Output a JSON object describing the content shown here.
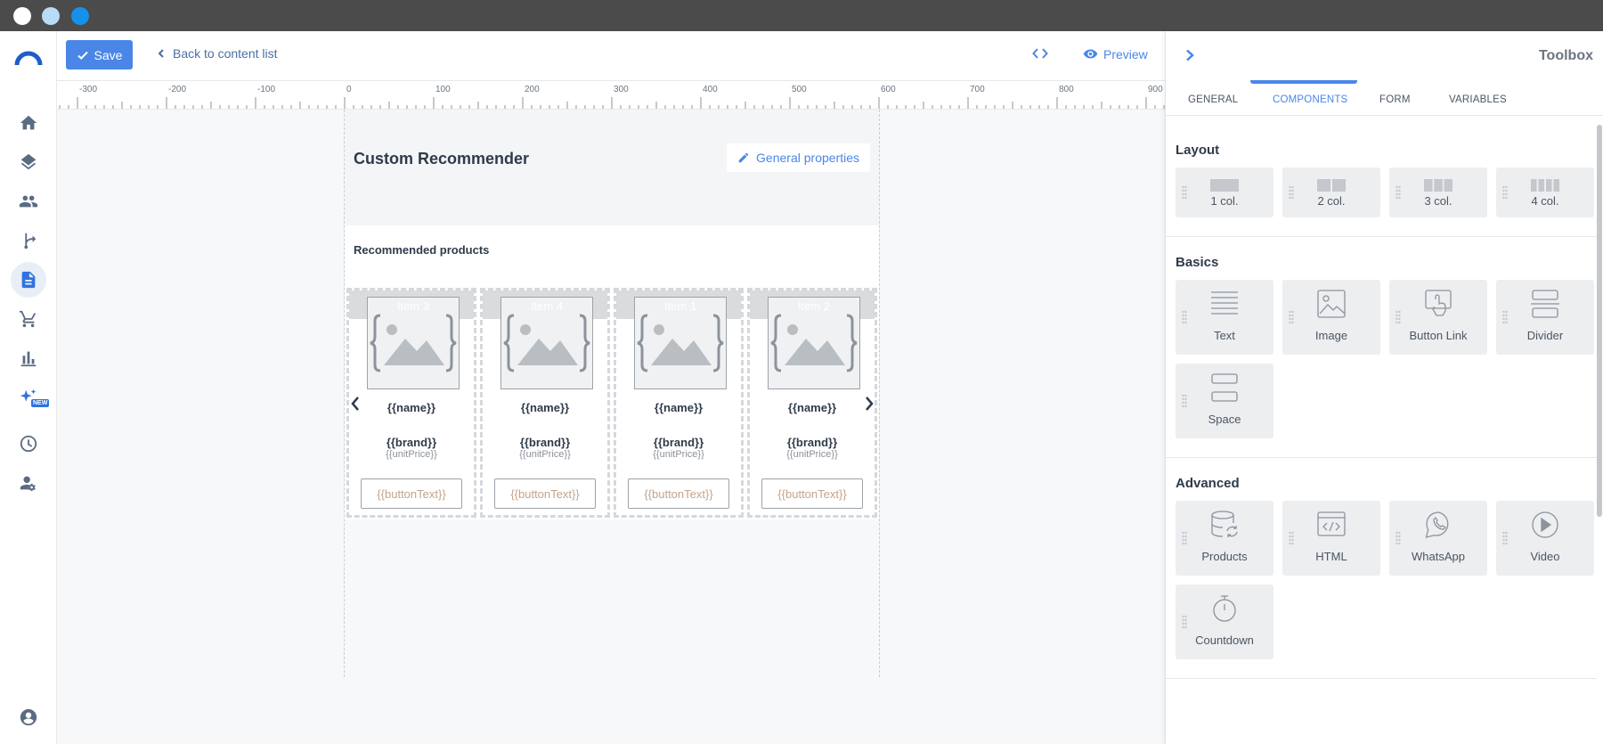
{
  "window": {
    "buttons": [
      "close",
      "minimize",
      "maximize"
    ]
  },
  "sidebar": {
    "items": [
      {
        "name": "home",
        "icon": "home-icon"
      },
      {
        "name": "layers",
        "icon": "layers-icon"
      },
      {
        "name": "people",
        "icon": "people-icon"
      },
      {
        "name": "journeys",
        "icon": "branch-icon"
      },
      {
        "name": "content",
        "icon": "document-icon",
        "active": true
      },
      {
        "name": "commerce",
        "icon": "cart-icon"
      },
      {
        "name": "analytics",
        "icon": "bar-chart-icon"
      },
      {
        "name": "ai",
        "icon": "sparkles-icon",
        "badge": "NEW"
      },
      {
        "name": "dashboard",
        "icon": "gauge-icon"
      },
      {
        "name": "user-settings",
        "icon": "user-gear-icon"
      }
    ],
    "account_icon": "account-circle-icon"
  },
  "topbar": {
    "save_label": "Save",
    "back_label": "Back to content list",
    "preview_label": "Preview"
  },
  "ruler": {
    "labels": [
      "-300",
      "-200",
      "-100",
      "0",
      "100",
      "200",
      "300",
      "400",
      "500",
      "600",
      "700",
      "800",
      "900"
    ]
  },
  "email": {
    "title": "Custom Recommender",
    "general_properties_label": "General properties",
    "recommended_title": "Recommended products",
    "cards": [
      {
        "item_label": "Item 3",
        "name": "{{name}}",
        "brand": "{{brand}}",
        "price": "{{unitPrice}}",
        "button": "{{buttonText}}"
      },
      {
        "item_label": "Item 4",
        "name": "{{name}}",
        "brand": "{{brand}}",
        "price": "{{unitPrice}}",
        "button": "{{buttonText}}"
      },
      {
        "item_label": "Item 1",
        "name": "{{name}}",
        "brand": "{{brand}}",
        "price": "{{unitPrice}}",
        "button": "{{buttonText}}"
      },
      {
        "item_label": "Item 2",
        "name": "{{name}}",
        "brand": "{{brand}}",
        "price": "{{unitPrice}}",
        "button": "{{buttonText}}"
      }
    ]
  },
  "toolbox": {
    "title": "Toolbox",
    "tabs": [
      {
        "label": "GENERAL"
      },
      {
        "label": "COMPONENTS",
        "active": true
      },
      {
        "label": "FORM"
      },
      {
        "label": "VARIABLES"
      }
    ],
    "sections": {
      "layout": {
        "title": "Layout",
        "items": [
          {
            "label": "1 col."
          },
          {
            "label": "2 col."
          },
          {
            "label": "3 col."
          },
          {
            "label": "4 col."
          }
        ]
      },
      "basics": {
        "title": "Basics",
        "items": [
          {
            "label": "Text"
          },
          {
            "label": "Image"
          },
          {
            "label": "Button Link"
          },
          {
            "label": "Divider"
          },
          {
            "label": "Space"
          }
        ]
      },
      "advanced": {
        "title": "Advanced",
        "items": [
          {
            "label": "Products"
          },
          {
            "label": "HTML"
          },
          {
            "label": "WhatsApp"
          },
          {
            "label": "Video"
          },
          {
            "label": "Countdown"
          }
        ]
      }
    }
  },
  "colors": {
    "accent": "#4a86e8",
    "titlebar": "#4b4b4b"
  }
}
